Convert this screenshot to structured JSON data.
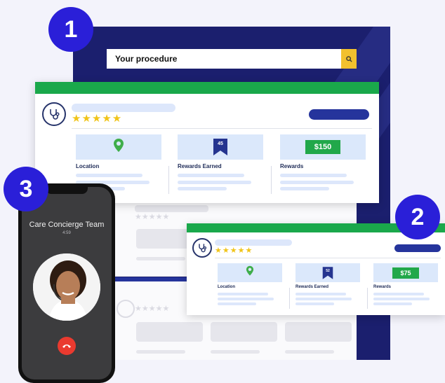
{
  "search": {
    "text": "Your procedure",
    "button_icon": "search-icon"
  },
  "badges": [
    "1",
    "2",
    "3"
  ],
  "card_main": {
    "stars": "★★★★★",
    "tiles": [
      {
        "label": "Location",
        "icon": "map-pin-icon"
      },
      {
        "label": "Rewards Earned",
        "icon": "bookmark-icon",
        "count": "45"
      },
      {
        "label": "Rewards",
        "price": "$150"
      }
    ]
  },
  "card_small": {
    "stars": "★★★★★",
    "tiles": [
      {
        "label": "Location",
        "icon": "map-pin-icon"
      },
      {
        "label": "Rewards Earned",
        "icon": "bookmark-icon",
        "count": "52"
      },
      {
        "label": "Rewards",
        "price": "$75"
      }
    ]
  },
  "phone": {
    "title": "Care Concierge Team",
    "time": "4:59",
    "end_call_icon": "phone-hangup-icon"
  },
  "colors": {
    "navy": "#1b1f6e",
    "green": "#1aa84b",
    "badge": "#2a1fd8",
    "star": "#f0c419",
    "end_call": "#ea3a2f"
  }
}
